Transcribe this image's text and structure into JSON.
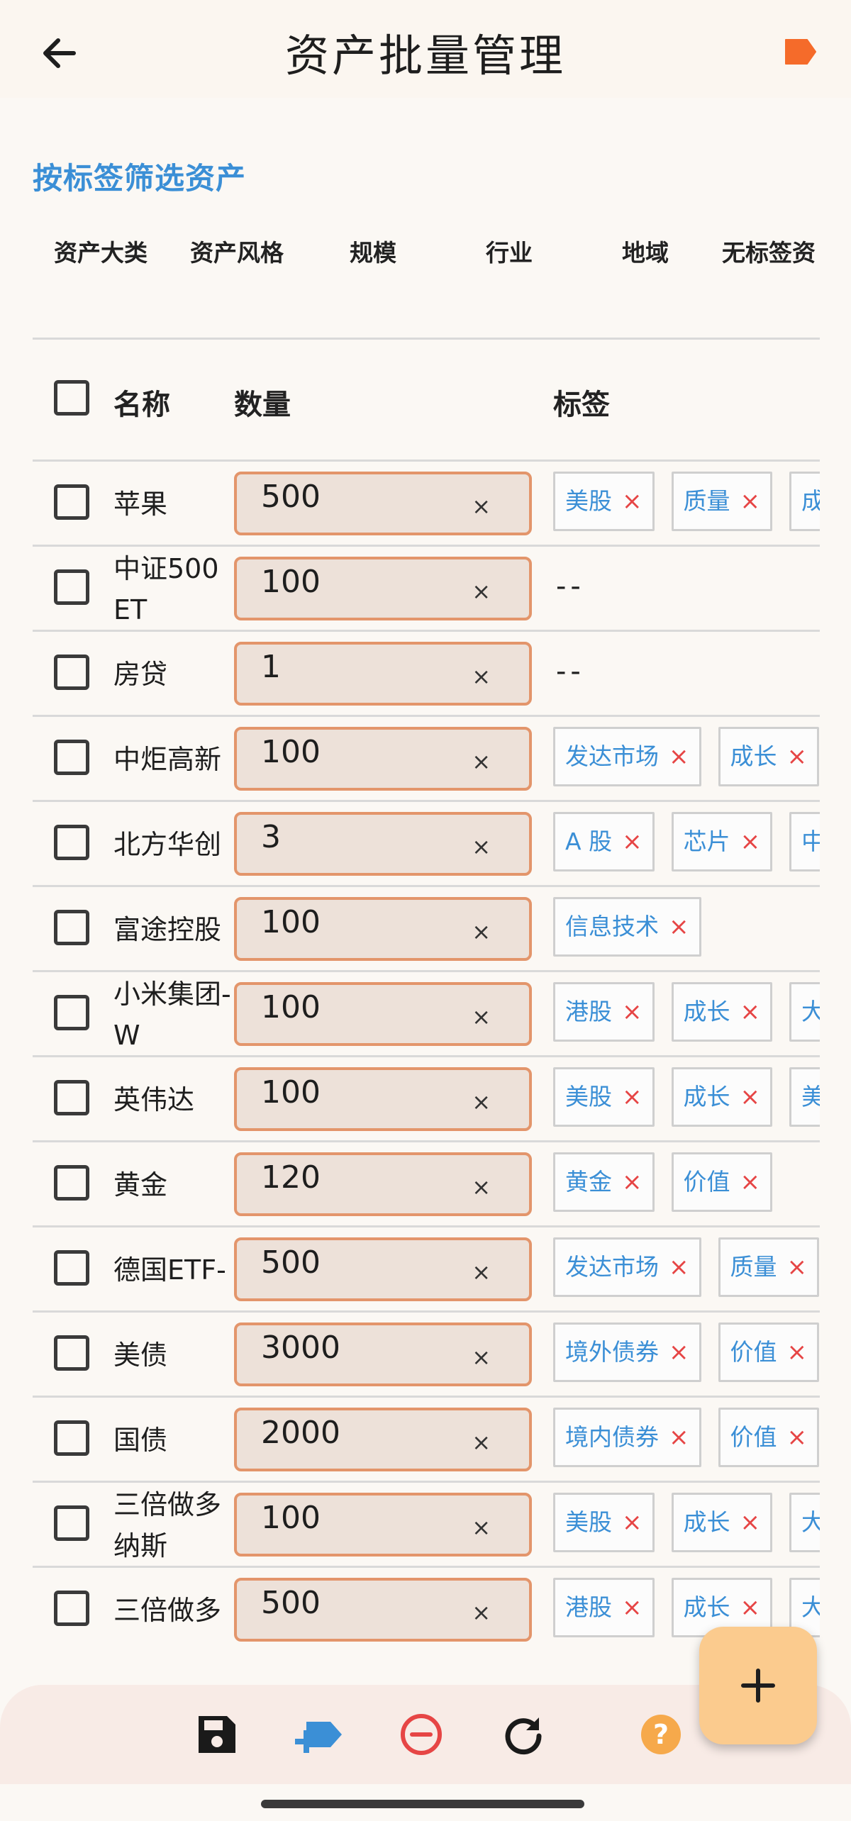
{
  "appbar": {
    "title": "资产批量管理",
    "back_icon": "arrow-left-icon",
    "tag_icon": "label-tag-icon",
    "accent_color": "#F56B2A"
  },
  "filter": {
    "title": "按标签筛选资产",
    "tabs": [
      "资产大类",
      "资产风格",
      "规模",
      "行业",
      "地域",
      "无标签资"
    ]
  },
  "table": {
    "headers": {
      "name": "名称",
      "quantity": "数量",
      "tags": "标签"
    },
    "rows": [
      {
        "name": "苹果",
        "quantity": "500",
        "tags": [
          "美股",
          "质量",
          "成"
        ]
      },
      {
        "name": "中证500ET",
        "quantity": "100",
        "tags": [],
        "empty": "--"
      },
      {
        "name": "房贷",
        "quantity": "1",
        "tags": [],
        "empty": "--"
      },
      {
        "name": "中炬高新",
        "quantity": "100",
        "tags": [
          "发达市场",
          "成长"
        ]
      },
      {
        "name": "北方华创",
        "quantity": "3",
        "tags": [
          "A 股",
          "芯片",
          "中"
        ]
      },
      {
        "name": "富途控股",
        "quantity": "100",
        "tags": [
          "信息技术"
        ]
      },
      {
        "name": "小米集团-W",
        "quantity": "100",
        "tags": [
          "港股",
          "成长",
          "大"
        ]
      },
      {
        "name": "英伟达",
        "quantity": "100",
        "tags": [
          "美股",
          "成长",
          "美"
        ]
      },
      {
        "name": "黄金",
        "quantity": "120",
        "tags": [
          "黄金",
          "价值"
        ]
      },
      {
        "name": "德国ETF-",
        "quantity": "500",
        "tags": [
          "发达市场",
          "质量"
        ]
      },
      {
        "name": "美债",
        "quantity": "3000",
        "tags": [
          "境外债券",
          "价值"
        ]
      },
      {
        "name": "国债",
        "quantity": "2000",
        "tags": [
          "境内债券",
          "价值"
        ]
      },
      {
        "name": "三倍做多纳斯",
        "quantity": "100",
        "tags": [
          "美股",
          "成长",
          "大"
        ]
      },
      {
        "name": "三倍做多",
        "quantity": "500",
        "tags": [
          "港股",
          "成长",
          "大"
        ]
      }
    ],
    "clear_glyph": "×",
    "tag_remove_glyph": "×"
  },
  "bottom_bar": {
    "icons": [
      "save-icon",
      "add-tag-icon",
      "remove-circle-icon",
      "refresh-icon",
      "help-icon"
    ],
    "help_glyph": "?"
  },
  "fab": {
    "icon": "plus-icon",
    "glyph": "+"
  },
  "colors": {
    "link_blue": "#3B8FD6",
    "remove_red": "#E64545",
    "qty_border": "#E3956B",
    "qty_fill": "#EDE1D9",
    "fab_fill": "#FBCB8E",
    "help_orange": "#F6A94B"
  }
}
